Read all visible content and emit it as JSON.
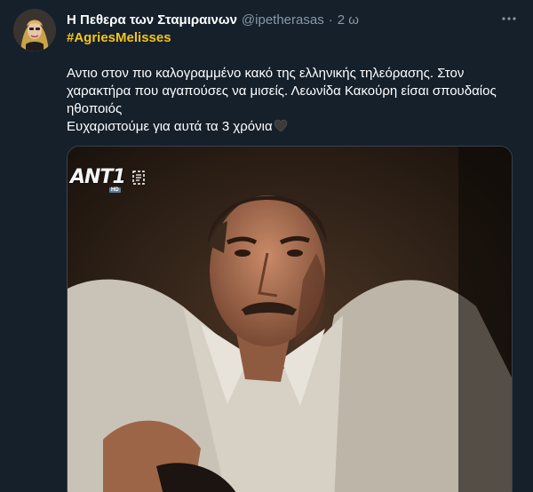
{
  "tweet": {
    "display_name": "Η Πεθερα των Σταμιραινων",
    "handle": "@ipetherasas",
    "separator": "·",
    "time": "2 ω",
    "hashtag": "#AgriesMelisses",
    "lines": [
      "Αντιο στον πιο καλογραμμένο κακό της ελληνικής τηλεόρασης. Στον χαρακτήρα που αγαπούσες να μισείς. Λεωνίδα Κακούρη είσαι σπουδαίος ηθοποιός",
      "Ευχαριστούμε για αυτά τα 3 χρόνια"
    ],
    "heart_emoji": "black-heart-emoji"
  },
  "media": {
    "channel_logo": "ANT1",
    "logo_badge": "HD"
  },
  "colors": {
    "background": "#15202b",
    "hashtag": "#f5c518",
    "secondary_text": "#8899a6",
    "media_border": "#38444d"
  },
  "icons": {
    "more": "more-dots-icon",
    "rating": "age-rating-icon"
  }
}
